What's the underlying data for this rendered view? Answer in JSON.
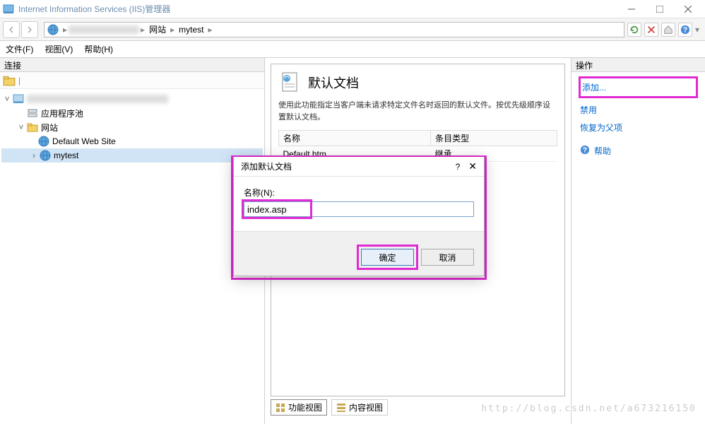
{
  "window": {
    "title": "Internet Information Services (IIS)管理器"
  },
  "breadcrumb": {
    "items": [
      "网站",
      "mytest"
    ]
  },
  "menu": {
    "file": "文件(F)",
    "view": "视图(V)",
    "help": "帮助(H)"
  },
  "left_panel": {
    "header": "连接"
  },
  "tree": {
    "app_pools": "应用程序池",
    "sites": "网站",
    "default_site": "Default Web Site",
    "mytest": "mytest"
  },
  "center": {
    "title": "默认文档",
    "description": "使用此功能指定当客户端未请求特定文件名时返回的默认文件。按优先级顺序设置默认文档。",
    "columns": [
      "名称",
      "条目类型"
    ],
    "rows": [
      {
        "name": "Default.htm",
        "type": "继承"
      }
    ],
    "view_tabs": {
      "features": "功能视图",
      "content": "内容视图"
    }
  },
  "right_panel": {
    "header": "操作",
    "actions": {
      "add": "添加...",
      "disable": "禁用",
      "revert": "恢复为父项",
      "help": "帮助"
    }
  },
  "dialog": {
    "title": "添加默认文档",
    "name_label": "名称(N):",
    "name_value": "index.asp",
    "ok": "确定",
    "cancel": "取消"
  },
  "watermark": "http://blog.csdn.net/a673216150"
}
